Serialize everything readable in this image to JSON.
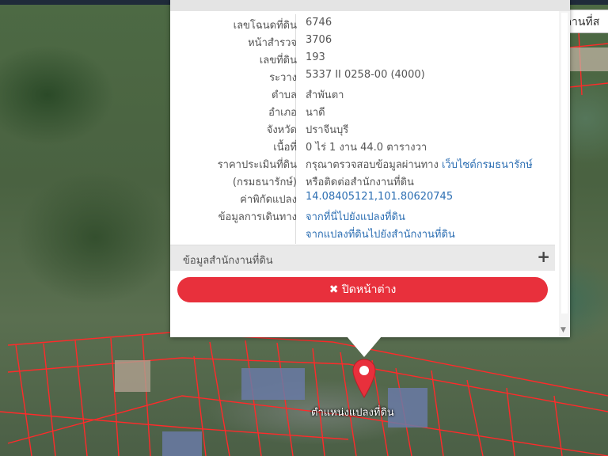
{
  "search": {
    "placeholder": "ค้นหาสถานที่ส"
  },
  "info": {
    "rows": [
      {
        "label": "เลขโฉนดที่ดิน",
        "value": "6746"
      },
      {
        "label": "หน้าสำรวจ",
        "value": "3706"
      },
      {
        "label": "เลขที่ดิน",
        "value": "193"
      },
      {
        "label": "ระวาง",
        "value": "5337 II 0258-00 (4000)"
      },
      {
        "label": "ตำบล",
        "value": "สำพันตา"
      },
      {
        "label": "อำเภอ",
        "value": "นาดี"
      },
      {
        "label": "จังหวัด",
        "value": "ปราจีนบุรี"
      },
      {
        "label": "เนื้อที่",
        "value": "0 ไร่ 1 งาน 44.0 ตารางวา"
      }
    ],
    "price_label": "ราคาประเมินที่ดิน",
    "price_text": "กรุณาตรวจสอบข้อมูลผ่านทาง",
    "price_link": "เว็บไซต์กรมธนารักษ์",
    "price_label2": "(กรมธนารักษ์)",
    "price_text2": "หรือติดต่อสำนักงานที่ดิน",
    "coord_label": "ค่าพิกัดแปลง",
    "coord_value": "14.08405121,101.80620745",
    "travel_label": "ข้อมูลการเดินทาง",
    "travel_link1": "จากที่นี่ไปยังแปลงที่ดิน",
    "travel_link2": "จากแปลงที่ดินไปยังสำนักงานที่ดิน"
  },
  "accordion": {
    "title": "ข้อมูลสำนักงานที่ดิน",
    "icon": "+"
  },
  "close_button": {
    "icon": "✖",
    "label": "ปิดหน้าต่าง"
  },
  "map": {
    "pin_label": "ตำแหน่งแปลงที่ดิน"
  },
  "colors": {
    "accent_red": "#e8303c",
    "link_blue": "#2d6fb3",
    "parcel_line": "#ff2a2a"
  }
}
